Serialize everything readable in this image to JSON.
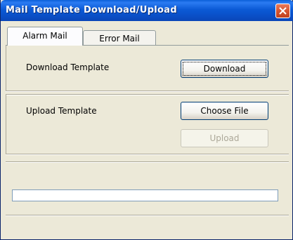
{
  "window": {
    "title": "Mail Template Download/Upload"
  },
  "tabs": [
    {
      "label": "Alarm Mail",
      "active": true
    },
    {
      "label": "Error Mail",
      "active": false
    }
  ],
  "download_section": {
    "label": "Download Template",
    "button_label": "Download"
  },
  "upload_section": {
    "label": "Upload Template",
    "choose_file_label": "Choose File",
    "upload_label": "Upload",
    "upload_enabled": false
  },
  "progress": {
    "value": 0
  },
  "icons": {
    "close": "close-icon"
  },
  "colors": {
    "titlebar": "#0a5fd8",
    "window_bg": "#ece9d8",
    "close_button": "#d65530"
  }
}
